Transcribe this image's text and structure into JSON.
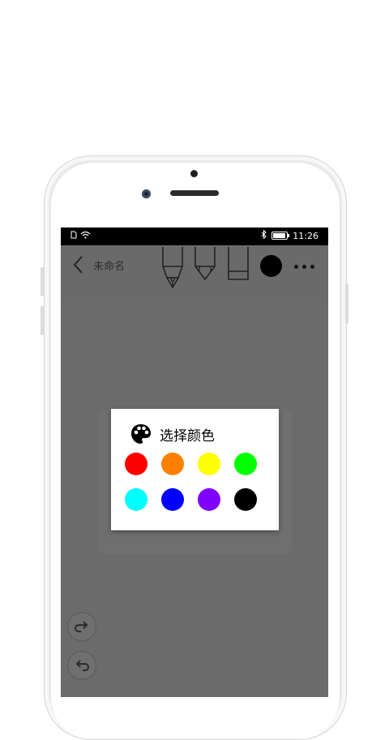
{
  "status_bar": {
    "time": "11:26",
    "icons": [
      "sim-icon",
      "wifi-icon",
      "bluetooth-icon",
      "battery-icon"
    ]
  },
  "toolbar": {
    "title": "未命名",
    "tools": [
      "fountain-pen-icon",
      "marker-icon",
      "eraser-icon"
    ],
    "current_color": "#000000",
    "back_icon": "chevron-left-icon",
    "more_icon": "more-dots-icon"
  },
  "dialog": {
    "title": "选择颜色",
    "icon": "palette-icon",
    "colors": [
      "#ff0000",
      "#ff8000",
      "#ffff00",
      "#00ff00",
      "#00ffff",
      "#0000ff",
      "#8000ff",
      "#000000"
    ]
  },
  "floating_buttons": [
    "redo-icon",
    "undo-icon"
  ]
}
